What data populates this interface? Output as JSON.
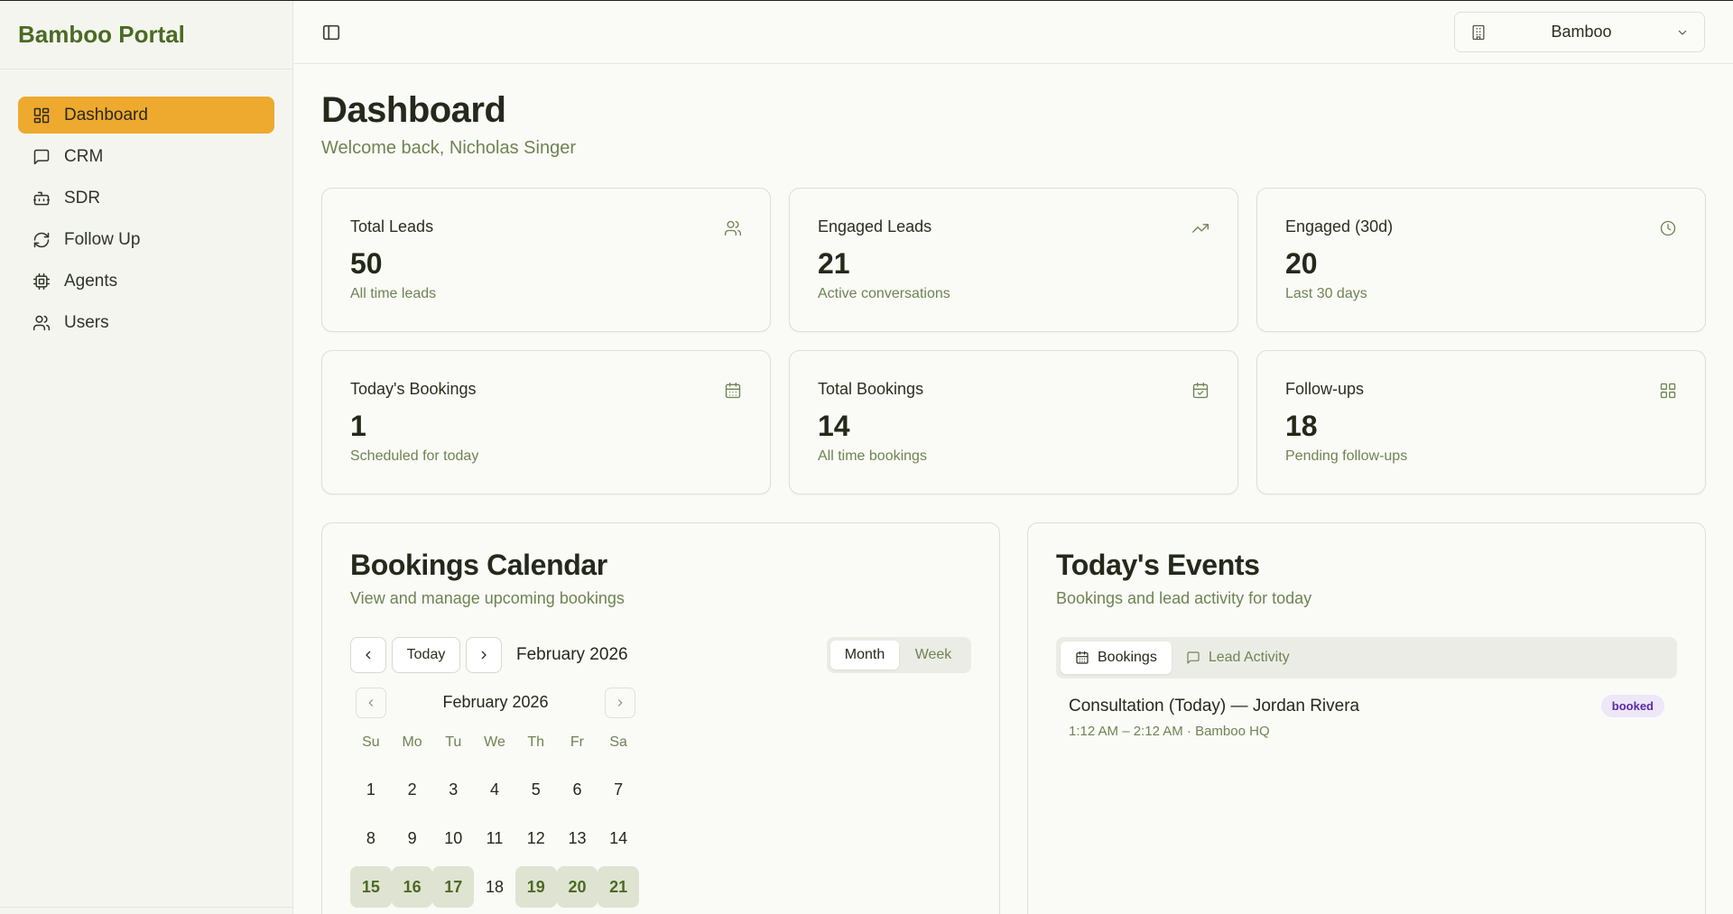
{
  "app": {
    "brand": "Bamboo Portal"
  },
  "sidebar": {
    "items": [
      {
        "label": "Dashboard",
        "icon": "dashboard-icon",
        "active": true
      },
      {
        "label": "CRM",
        "icon": "message-icon"
      },
      {
        "label": "SDR",
        "icon": "bot-icon"
      },
      {
        "label": "Follow Up",
        "icon": "refresh-icon"
      },
      {
        "label": "Agents",
        "icon": "cpu-icon"
      },
      {
        "label": "Users",
        "icon": "users-icon"
      }
    ]
  },
  "header": {
    "org_select": "Bamboo"
  },
  "page": {
    "title": "Dashboard",
    "subtitle": "Welcome back, Nicholas Singer"
  },
  "stats": [
    {
      "title": "Total Leads",
      "value": "50",
      "desc": "All time leads",
      "icon": "users-icon"
    },
    {
      "title": "Engaged Leads",
      "value": "21",
      "desc": "Active conversations",
      "icon": "trending-up-icon"
    },
    {
      "title": "Engaged (30d)",
      "value": "20",
      "desc": "Last 30 days",
      "icon": "clock-icon"
    },
    {
      "title": "Today's Bookings",
      "value": "1",
      "desc": "Scheduled for today",
      "icon": "calendar-icon"
    },
    {
      "title": "Total Bookings",
      "value": "14",
      "desc": "All time bookings",
      "icon": "calendar-check-icon"
    },
    {
      "title": "Follow-ups",
      "value": "18",
      "desc": "Pending follow-ups",
      "icon": "grid-icon"
    }
  ],
  "calendar": {
    "title": "Bookings Calendar",
    "subtitle": "View and manage upcoming bookings",
    "today_label": "Today",
    "month_label": "February 2026",
    "view_month": "Month",
    "view_week": "Week",
    "mini_title": "February 2026",
    "dow": [
      "Su",
      "Mo",
      "Tu",
      "We",
      "Th",
      "Fr",
      "Sa"
    ],
    "weeks": [
      [
        "1",
        "2",
        "3",
        "4",
        "5",
        "6",
        "7"
      ],
      [
        "8",
        "9",
        "10",
        "11",
        "12",
        "13",
        "14"
      ],
      [
        "15",
        "16",
        "17",
        "18",
        "19",
        "20",
        "21"
      ]
    ],
    "booked_days": [
      "15",
      "16",
      "17",
      "19",
      "20",
      "21"
    ]
  },
  "events": {
    "title": "Today's Events",
    "subtitle": "Bookings and lead activity for today",
    "tab_bookings": "Bookings",
    "tab_activity": "Lead Activity",
    "items": [
      {
        "title": "Consultation (Today) — Jordan Rivera",
        "meta": "1:12 AM – 2:12 AM · Bamboo HQ",
        "status": "booked"
      }
    ]
  }
}
